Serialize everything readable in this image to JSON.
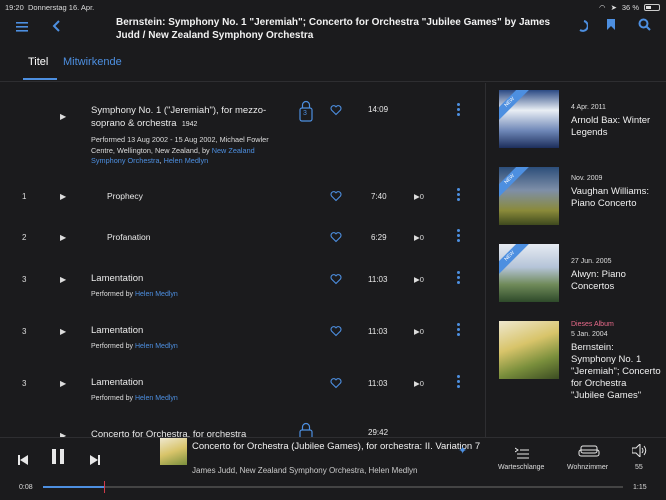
{
  "status": {
    "time": "19:20",
    "date": "Donnerstag 16. Apr.",
    "battery": "36 %"
  },
  "header": {
    "title": "Bernstein: Symphony No. 1 \"Jeremiah\"; Concerto for Orchestra \"Jubilee Games\" by James Judd / New Zealand Symphony Orchestra"
  },
  "tabs": [
    {
      "label": "Titel"
    },
    {
      "label": "Mitwirkende"
    }
  ],
  "tracks": [
    {
      "title": "Symphony No. 1 (\"Jeremiah\"), for mezzo-soprano & orchestra",
      "year": "1942",
      "lock_count": "3",
      "performed": "Performed 13 Aug 2002 - 15 Aug 2002, Michael Fowler Centre, Wellington, New Zealand, by",
      "performer_links": "New Zealand Symphony Orchestra",
      "sep": ", ",
      "performer_link2": "Helen Medlyn",
      "duration": "14:09"
    },
    {
      "num": "1",
      "title": "Prophecy",
      "duration": "7:40",
      "plays": "0"
    },
    {
      "num": "2",
      "title": "Profanation",
      "duration": "6:29",
      "plays": "0"
    },
    {
      "num": "3",
      "title": "Lamentation",
      "performed_by": "Performed by",
      "performer": "Helen Medlyn",
      "duration": "11:03",
      "plays": "0"
    },
    {
      "num": "3",
      "title": "Lamentation",
      "performed_by": "Performed by",
      "performer": "Helen Medlyn",
      "duration": "11:03",
      "plays": "0"
    },
    {
      "num": "3",
      "title": "Lamentation",
      "performed_by": "Performed by",
      "performer": "Helen Medlyn",
      "duration": "11:03",
      "plays": "0"
    },
    {
      "title": "Concerto for Orchestra, for orchestra",
      "duration": "29:42"
    }
  ],
  "albums": [
    {
      "date": "4 Apr. 2011",
      "name": "Arnold Bax: Winter Legends",
      "ribbon": "NEW"
    },
    {
      "date": "Nov. 2009",
      "name": "Vaughan Williams: Piano Concerto",
      "ribbon": "NEW"
    },
    {
      "date": "27 Jun. 2005",
      "name": "Alwyn: Piano Concertos",
      "ribbon": "NEW"
    },
    {
      "badge": "Dieses Album",
      "date": "5 Jan. 2004",
      "name": "Bernstein: Symphony No. 1 \"Jeremiah\"; Concerto for Orchestra \"Jubilee Games\""
    }
  ],
  "player": {
    "title": "Concerto for Orchestra (Jubilee Games), for orchestra: II. Variation 7",
    "artist": "James Judd, New Zealand Symphony Orchestra, Helen Medlyn",
    "queue_label": "Warteschlange",
    "room_label": "Wohnzimmer",
    "volume": "55",
    "elapsed": "0:08",
    "total": "1:15",
    "progress": 0.107
  },
  "colors": {
    "accent": "#4d8fe0",
    "bg": "#1b1b1d",
    "badge": "#e86a8a"
  }
}
